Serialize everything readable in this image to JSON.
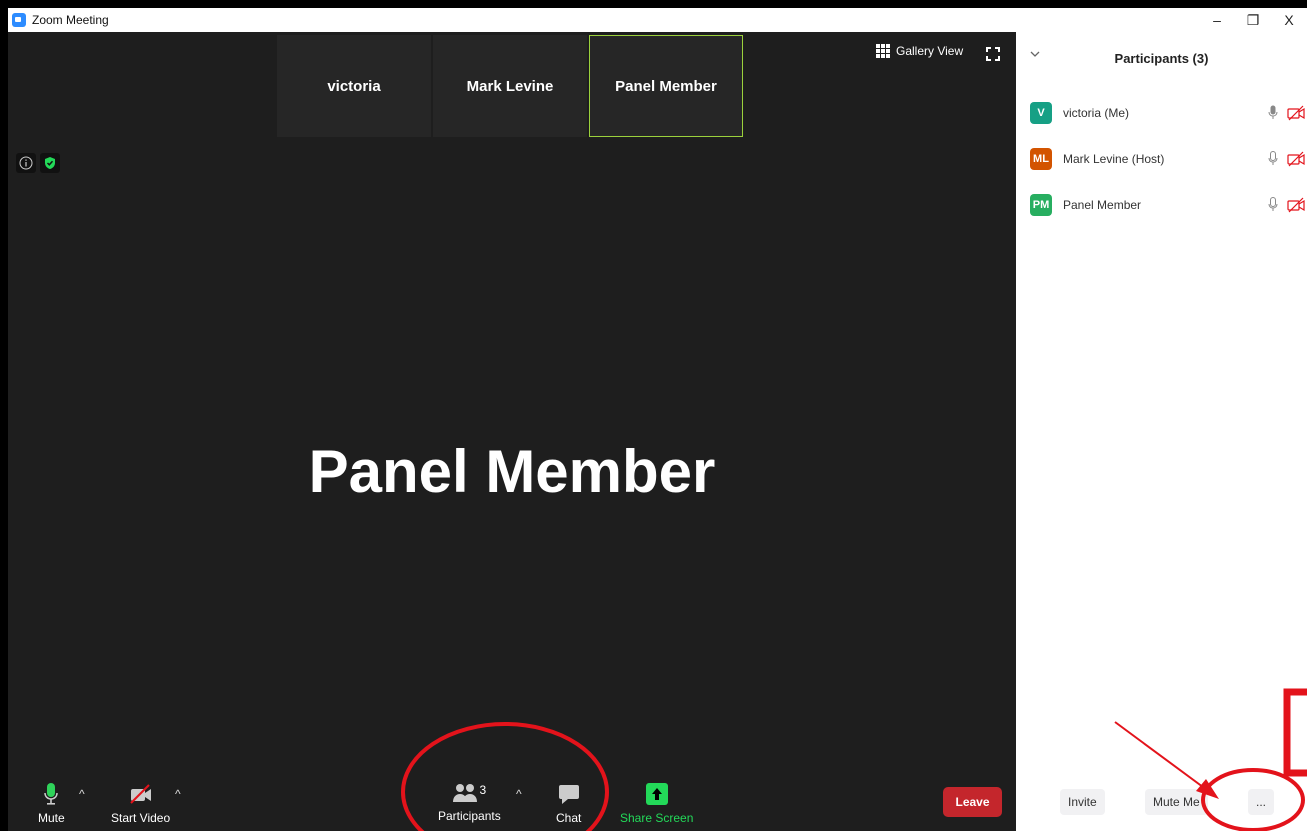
{
  "window": {
    "title": "Zoom Meeting",
    "controls": {
      "minimize": "–",
      "restore": "❐",
      "close": "X"
    }
  },
  "video": {
    "thumbnails": [
      {
        "name": "victoria",
        "active": false
      },
      {
        "name": "Mark Levine",
        "active": false
      },
      {
        "name": "Panel Member",
        "active": true
      }
    ],
    "gallery_view_label": "Gallery View",
    "active_speaker": "Panel Member"
  },
  "toolbar": {
    "mute_label": "Mute",
    "start_video_label": "Start Video",
    "participants_label": "Participants",
    "participants_count": "3",
    "chat_label": "Chat",
    "share_screen_label": "Share Screen",
    "leave_label": "Leave",
    "share_color": "#23d959",
    "leave_color": "#c4262c"
  },
  "participants_panel": {
    "title": "Participants (3)",
    "participants": [
      {
        "initials": "V",
        "name": "victoria (Me)",
        "avatar_color": "#16a085"
      },
      {
        "initials": "ML",
        "name": "Mark Levine (Host)",
        "avatar_color": "#d35400"
      },
      {
        "initials": "PM",
        "name": "Panel Member",
        "avatar_color": "#27ae60"
      }
    ],
    "invite_label": "Invite",
    "mute_me_label": "Mute Me",
    "more_label": "..."
  },
  "annotation_color": "#e3131b"
}
